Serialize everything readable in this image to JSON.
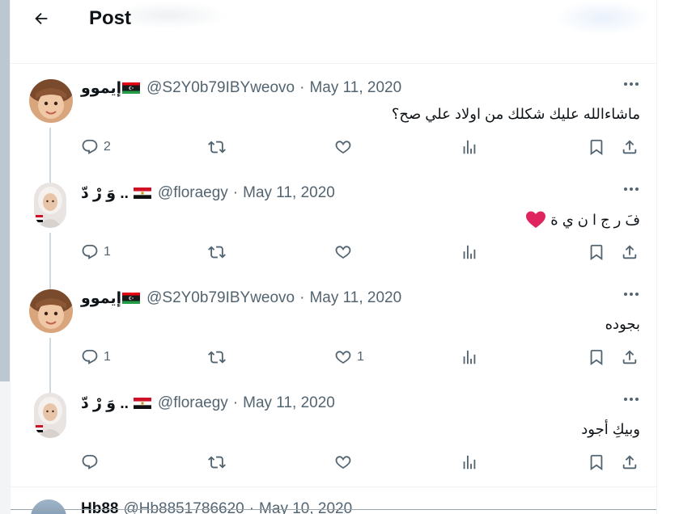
{
  "header": {
    "title": "Post"
  },
  "tweets": [
    {
      "name": "إيموو",
      "handle": "@S2Y0b79IBYweovo",
      "separator": "·",
      "date": "May 11, 2020",
      "text": "ماشاءالله عليك شكلك من اولاد علي صح؟",
      "replies": "2",
      "likes": ""
    },
    {
      "name": "وَ رْ دّ ..",
      "handle": "@floraegy",
      "separator": "·",
      "date": "May 11, 2020",
      "text": "فَ ر ج ا ن ي ة",
      "replies": "1",
      "likes": ""
    },
    {
      "name": "إيموو",
      "handle": "@S2Y0b79IBYweovo",
      "separator": "·",
      "date": "May 11, 2020",
      "text": "بجوده",
      "replies": "1",
      "likes": "1"
    },
    {
      "name": "وَ رْ دّ ..",
      "handle": "@floraegy",
      "separator": "·",
      "date": "May 11, 2020",
      "text": "وبيكِ أجود",
      "replies": "",
      "likes": ""
    }
  ],
  "next_tweet": {
    "name": "Hb88",
    "handle": "@Hb8851786620",
    "separator": "·",
    "date": "May 10, 2020"
  },
  "colors": {
    "text_primary": "#0f1419",
    "text_secondary": "#536471",
    "heart_red": "#e0245e",
    "divider": "#eff3f4",
    "thread_line": "#cfd9de"
  }
}
